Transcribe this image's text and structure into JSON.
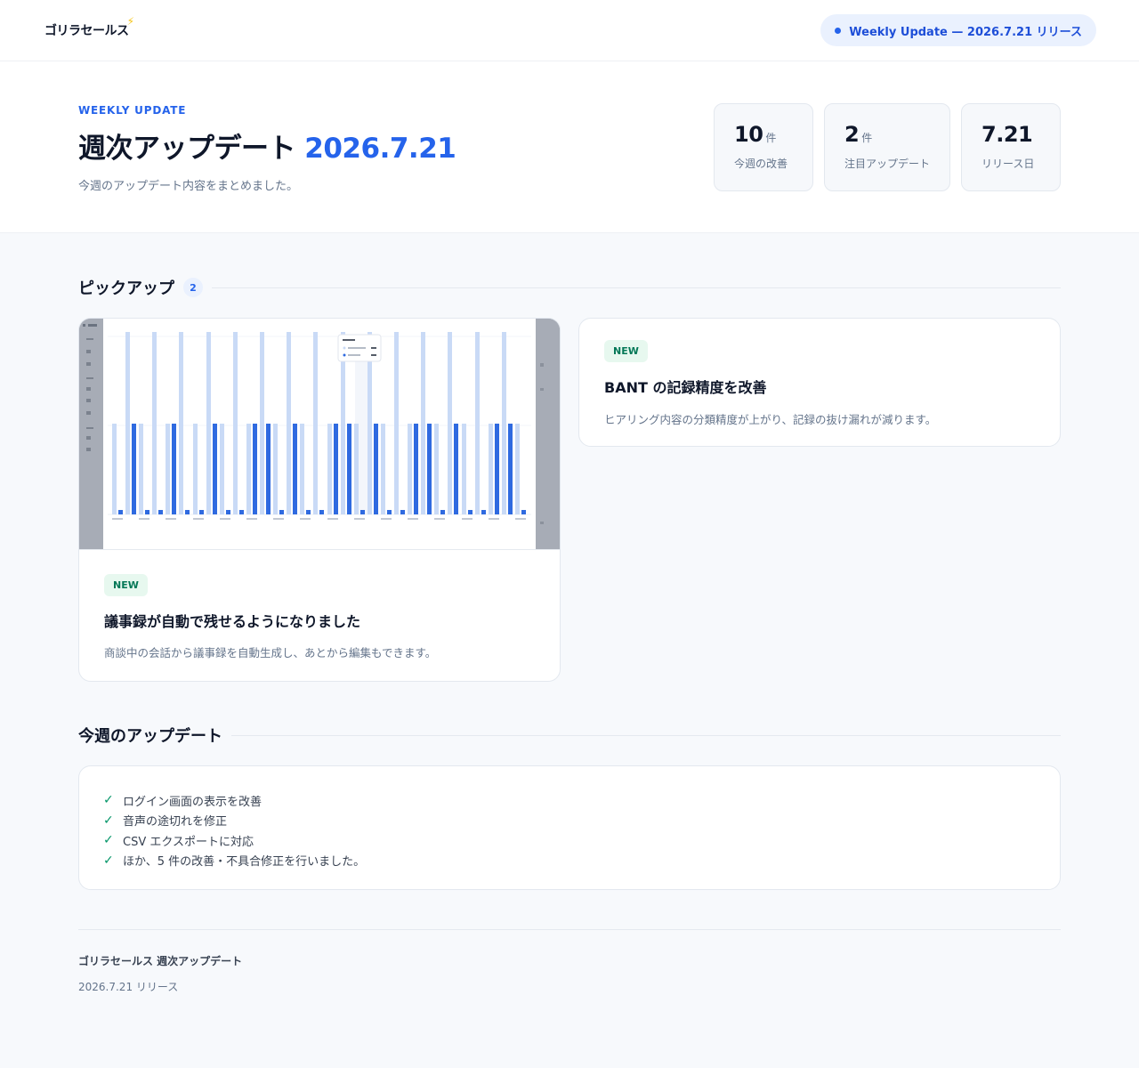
{
  "brand": {
    "logo_text": "ゴリラセールス"
  },
  "header": {
    "release_pill": "Weekly Update — 2026.7.21 リリース"
  },
  "hero": {
    "eyebrow": "WEEKLY UPDATE",
    "title": "週次アップデート",
    "title_accent": "2026.7.21",
    "subtitle": "今週のアップデート内容をまとめました。",
    "stats": [
      {
        "value": "10",
        "unit": "件",
        "label": "今週の改善"
      },
      {
        "value": "2",
        "unit": "件",
        "label": "注目アップデート"
      },
      {
        "value": "7.21",
        "unit": "",
        "label": "リリース日"
      }
    ]
  },
  "pickup": {
    "title": "ピックアップ",
    "count": "2",
    "cards": [
      {
        "badge": "NEW",
        "title": "議事録が自動で残せるようになりました",
        "description": "商談中の会話から議事録を自動生成し、あとから編集もできます。"
      },
      {
        "badge": "NEW",
        "title": "BANT の記録精度を改善",
        "description": "ヒアリング内容の分類精度が上がり、記録の抜け漏れが減ります。"
      }
    ]
  },
  "updates": {
    "title": "今週のアップデート",
    "items": [
      "ログイン画面の表示を改善",
      "音声の途切れを修正",
      "CSV エクスポートに対応",
      "ほか、5 件の改善・不具合修正を行いました。"
    ]
  },
  "footer": {
    "title": "ゴリラセールス 週次アップデート",
    "subtitle": "2026.7.21 リリース"
  },
  "colors": {
    "accent": "#2563eb",
    "new_badge_bg": "#e7f8ef",
    "new_badge_text": "#047857",
    "check": "#059669"
  }
}
